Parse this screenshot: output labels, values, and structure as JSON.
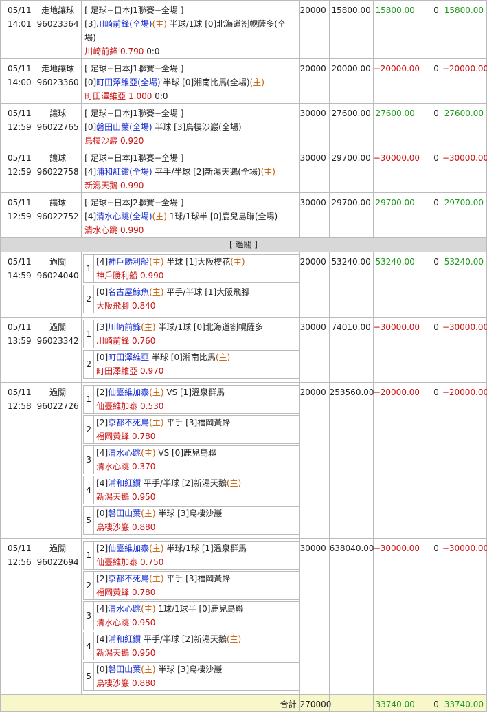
{
  "colors": {
    "team": "#1a2fd0",
    "home": "#c55a00",
    "pick": "#cc1111",
    "win": "#1b9a1b",
    "lose": "#cc1111",
    "section_bg": "#d8d8d8",
    "total_bg": "#f8f7c9"
  },
  "singles": [
    {
      "date": "05/11",
      "time": "14:01",
      "type": "走地讓球",
      "id": "96023364",
      "league": "[ 足球−日本J1聯賽−全場 ]",
      "l2a": "[3]",
      "team1": "川崎前鋒(全場)",
      "h1": "(主)",
      "mid": " 半球/1球 [0]",
      "team2": "北海道劄幌薩多(全場)",
      "h2": "",
      "pick": "川崎前鋒",
      "odds": "0.790",
      "score": "0:0",
      "amount": "20000",
      "winnable": "15800.00",
      "result": "15800.00",
      "result_cls": "green",
      "commission": "0",
      "net": "15800.00"
    },
    {
      "date": "05/11",
      "time": "14:00",
      "type": "走地讓球",
      "id": "96023360",
      "league": "[ 足球−日本J1聯賽−全場 ]",
      "l2a": "[0]",
      "team1": "町田澤維亞(全場)",
      "h1": "",
      "mid": " 半球 [0]",
      "team2": "湘南比馬(全場)",
      "h2": "(主)",
      "pick": "町田澤維亞",
      "odds": "1.000",
      "score": "0:0",
      "amount": "20000",
      "winnable": "20000.00",
      "result": "−20000.00",
      "result_cls": "red",
      "commission": "0",
      "net": "−20000.00"
    },
    {
      "date": "05/11",
      "time": "12:59",
      "type": "讓球",
      "id": "96022765",
      "league": "[ 足球−日本J1聯賽−全場 ]",
      "l2a": "[0]",
      "team1": "磐田山葉(全場)",
      "h1": "",
      "mid": " 半球 [3]",
      "team2": "鳥棲沙巖(全場)",
      "h2": "",
      "pick": "鳥棲沙巖",
      "odds": "0.920",
      "score": "",
      "amount": "30000",
      "winnable": "27600.00",
      "result": "27600.00",
      "result_cls": "green",
      "commission": "0",
      "net": "27600.00"
    },
    {
      "date": "05/11",
      "time": "12:59",
      "type": "讓球",
      "id": "96022758",
      "league": "[ 足球−日本J1聯賽−全場 ]",
      "l2a": "[4]",
      "team1": "浦和紅鑽(全場)",
      "h1": "",
      "mid": " 平手/半球 [2]",
      "team2": "新潟天鵝(全場)",
      "h2": "(主)",
      "pick": "新潟天鵝",
      "odds": "0.990",
      "score": "",
      "amount": "30000",
      "winnable": "29700.00",
      "result": "−30000.00",
      "result_cls": "red",
      "commission": "0",
      "net": "−30000.00"
    },
    {
      "date": "05/11",
      "time": "12:59",
      "type": "讓球",
      "id": "96022752",
      "league": "[ 足球−日本J2聯賽−全場 ]",
      "l2a": "[4]",
      "team1": "清水心跳(全場)",
      "h1": "(主)",
      "mid": " 1球/1球半 [0]",
      "team2": "鹿兒島聯(全場)",
      "h2": "",
      "pick": "清水心跳",
      "odds": "0.990",
      "score": "",
      "amount": "30000",
      "winnable": "29700.00",
      "result": "29700.00",
      "result_cls": "green",
      "commission": "0",
      "net": "29700.00"
    }
  ],
  "section_label": "[ 過關 ]",
  "parlays": [
    {
      "date": "05/11",
      "time": "14:59",
      "type": "過關",
      "id": "96024040",
      "amount": "20000",
      "winnable": "53240.00",
      "result": "53240.00",
      "result_cls": "green",
      "commission": "0",
      "net": "53240.00",
      "legs": [
        {
          "n": "1",
          "a": "[4]",
          "t1": "神戶勝利船",
          "h1": "(主)",
          "mid": " 半球 [1]",
          "t2": "大阪櫻花",
          "h2": "(主)",
          "pick": "神戶勝利船",
          "odds": "0.990"
        },
        {
          "n": "2",
          "a": "[0]",
          "t1": "名古屋鯨魚",
          "h1": "(主)",
          "mid": " 平手/半球 [1]",
          "t2": "大阪飛腳",
          "h2": "",
          "pick": "大阪飛腳",
          "odds": "0.840"
        }
      ]
    },
    {
      "date": "05/11",
      "time": "13:59",
      "type": "過關",
      "id": "96023342",
      "amount": "30000",
      "winnable": "74010.00",
      "result": "−30000.00",
      "result_cls": "red",
      "commission": "0",
      "net": "−30000.00",
      "legs": [
        {
          "n": "1",
          "a": "[3]",
          "t1": "川崎前鋒",
          "h1": "(主)",
          "mid": " 半球/1球 [0]",
          "t2": "北海道劄幌薩多",
          "h2": "",
          "pick": "川崎前鋒",
          "odds": "0.760"
        },
        {
          "n": "2",
          "a": "[0]",
          "t1": "町田澤維亞",
          "h1": "",
          "mid": " 半球 [0]",
          "t2": "湘南比馬",
          "h2": "(主)",
          "pick": "町田澤維亞",
          "odds": "0.970"
        }
      ]
    },
    {
      "date": "05/11",
      "time": "12:58",
      "type": "過關",
      "id": "96022726",
      "amount": "20000",
      "winnable": "253560.00",
      "result": "−20000.00",
      "result_cls": "red",
      "commission": "0",
      "net": "−20000.00",
      "legs": [
        {
          "n": "1",
          "a": "[2]",
          "t1": "仙臺維加泰",
          "h1": "(主)",
          "mid": " VS [1]",
          "t2": "溫泉群馬",
          "h2": "",
          "pick": "仙臺維加泰",
          "odds": "0.530"
        },
        {
          "n": "2",
          "a": "[2]",
          "t1": "京都不死鳥",
          "h1": "(主)",
          "mid": " 平手 [3]",
          "t2": "福岡黃蜂",
          "h2": "",
          "pick": "福岡黃蜂",
          "odds": "0.780"
        },
        {
          "n": "3",
          "a": "[4]",
          "t1": "清水心跳",
          "h1": "(主)",
          "mid": " VS [0]",
          "t2": "鹿兒島聯",
          "h2": "",
          "pick": "清水心跳",
          "odds": "0.370"
        },
        {
          "n": "4",
          "a": "[4]",
          "t1": "浦和紅鑽",
          "h1": "",
          "mid": " 平手/半球 [2]",
          "t2": "新潟天鵝",
          "h2": "(主)",
          "pick": "新潟天鵝",
          "odds": "0.950"
        },
        {
          "n": "5",
          "a": "[0]",
          "t1": "磐田山葉",
          "h1": "(主)",
          "mid": " 半球 [3]",
          "t2": "鳥棲沙巖",
          "h2": "",
          "pick": "鳥棲沙巖",
          "odds": "0.880"
        }
      ]
    },
    {
      "date": "05/11",
      "time": "12:56",
      "type": "過關",
      "id": "96022694",
      "amount": "30000",
      "winnable": "638040.00",
      "result": "−30000.00",
      "result_cls": "red",
      "commission": "0",
      "net": "−30000.00",
      "legs": [
        {
          "n": "1",
          "a": "[2]",
          "t1": "仙臺維加泰",
          "h1": "(主)",
          "mid": " 半球/1球 [1]",
          "t2": "溫泉群馬",
          "h2": "",
          "pick": "仙臺維加泰",
          "odds": "0.750"
        },
        {
          "n": "2",
          "a": "[2]",
          "t1": "京都不死鳥",
          "h1": "(主)",
          "mid": " 平手 [3]",
          "t2": "福岡黃蜂",
          "h2": "",
          "pick": "福岡黃蜂",
          "odds": "0.780"
        },
        {
          "n": "3",
          "a": "[4]",
          "t1": "清水心跳",
          "h1": "(主)",
          "mid": " 1球/1球半 [0]",
          "t2": "鹿兒島聯",
          "h2": "",
          "pick": "清水心跳",
          "odds": "0.950"
        },
        {
          "n": "4",
          "a": "[4]",
          "t1": "浦和紅鑽",
          "h1": "",
          "mid": " 平手/半球 [2]",
          "t2": "新潟天鵝",
          "h2": "(主)",
          "pick": "新潟天鵝",
          "odds": "0.950"
        },
        {
          "n": "5",
          "a": "[0]",
          "t1": "磐田山葉",
          "h1": "(主)",
          "mid": " 半球 [3]",
          "t2": "鳥棲沙巖",
          "h2": "",
          "pick": "鳥棲沙巖",
          "odds": "0.880"
        }
      ]
    }
  ],
  "total": {
    "label": "合計",
    "amount": "270000",
    "result": "33740.00",
    "commission": "0",
    "net": "33740.00"
  }
}
